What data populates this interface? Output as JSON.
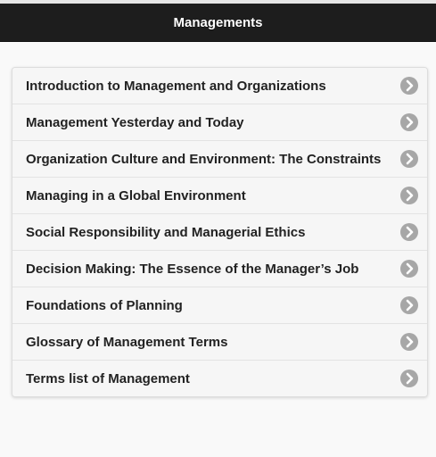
{
  "header": {
    "title": "Managements"
  },
  "list": {
    "items": [
      {
        "label": "Introduction to Management and Organizations"
      },
      {
        "label": "Management Yesterday and Today"
      },
      {
        "label": "Organization Culture and Environment: The Constraints"
      },
      {
        "label": "Managing in a Global Environment"
      },
      {
        "label": "Social Responsibility and Managerial Ethics"
      },
      {
        "label": "Decision Making: The Essence of the Manager’s Job"
      },
      {
        "label": "Foundations of Planning"
      },
      {
        "label": "Glossary of Management Terms"
      },
      {
        "label": "Terms list of Management"
      }
    ],
    "item_icon": "chevron-right-icon"
  },
  "colors": {
    "header_bg": "#1d1d1d",
    "page_bg": "#f9f9f9",
    "item_bg": "#f6f6f6",
    "chevron_bg": "#a7a7a7"
  }
}
